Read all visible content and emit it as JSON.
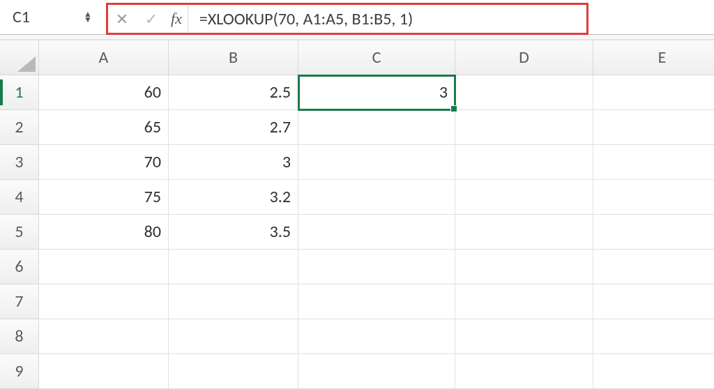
{
  "formula_bar": {
    "cell_ref": "C1",
    "fx_label": "fx",
    "formula": "=XLOOKUP(70, A1:A5, B1:B5, 1)"
  },
  "columns": [
    "A",
    "B",
    "C",
    "D",
    "E"
  ],
  "rows": [
    "1",
    "2",
    "3",
    "4",
    "5",
    "6",
    "7",
    "8",
    "9"
  ],
  "active_row_index": 0,
  "selection": {
    "col": "C",
    "row": "1"
  },
  "cells": {
    "A1": "60",
    "A2": "65",
    "A3": "70",
    "A4": "75",
    "A5": "80",
    "B1": "2.5",
    "B2": "2.7",
    "B3": "3",
    "B4": "3.2",
    "B5": "3.5",
    "C1": "3"
  },
  "accent_hex": "#197a4b",
  "highlight_border_hex": "#e23b3b"
}
